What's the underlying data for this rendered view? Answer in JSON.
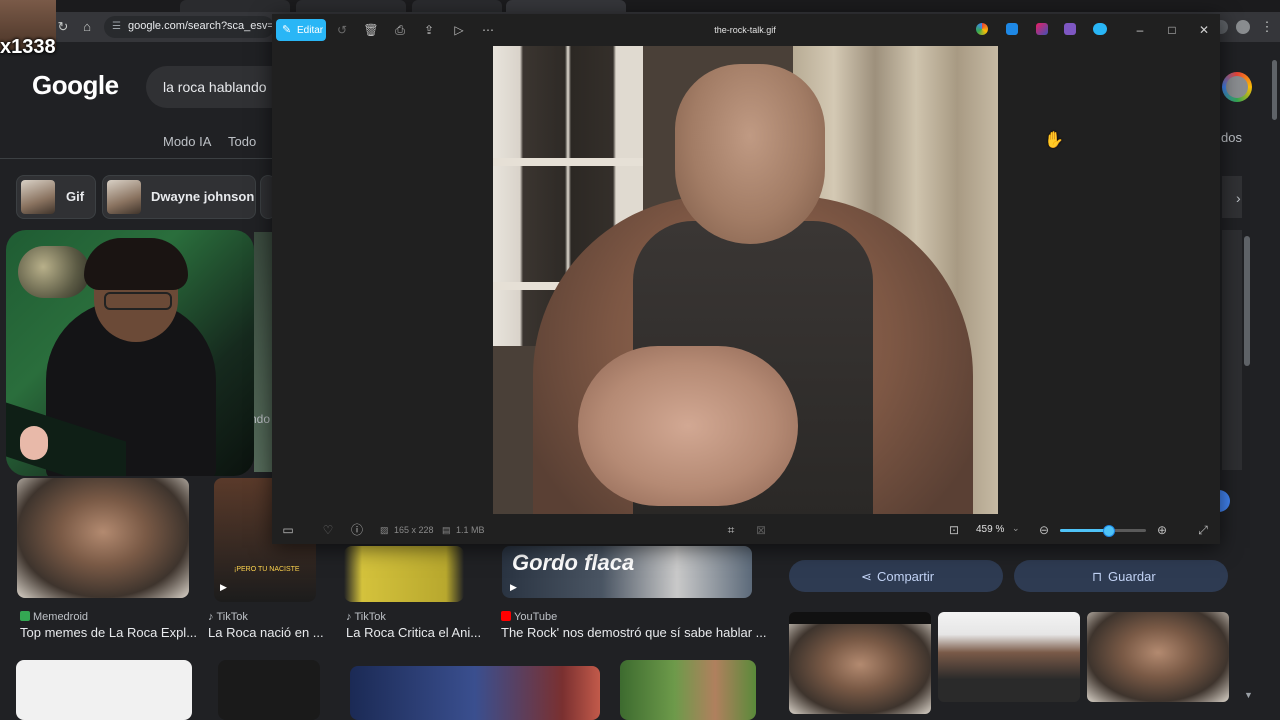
{
  "browser": {
    "address": "google.com/search?sca_esv=28495"
  },
  "overlay": {
    "streamer_name": "x1338"
  },
  "google": {
    "logo": "Google",
    "query": "la roca hablando",
    "tabs": [
      "Modo IA",
      "Todo"
    ],
    "chips": [
      {
        "label": "Gif"
      },
      {
        "label": "Dwayne johnson"
      }
    ],
    "partial_text": "ndo",
    "results": [
      {
        "source": "Memedroid",
        "title": "Top memes de La Roca Expl...",
        "color": "#34a853"
      },
      {
        "source": "TikTok",
        "title": "La Roca nació en ...",
        "color": "#000000"
      },
      {
        "source": "TikTok",
        "title": "La Roca Critica el Ani...",
        "color": "#000000"
      },
      {
        "source": "YouTube",
        "title": "The Rock' nos demostró que sí sabe hablar ...",
        "color": "#ff0000"
      }
    ],
    "thumb_caption": "¡PERO TU NACISTE",
    "gordo_text": "Gordo flaca"
  },
  "right_panel": {
    "tab_partial": "dos",
    "share_label": "Compartir",
    "save_label": "Guardar"
  },
  "viewer": {
    "edit_label": "Editar",
    "filename": "the-rock-talk.gif",
    "dimensions": "165 x 228",
    "filesize": "1.1 MB",
    "zoom": "459 %",
    "zoom_level": 0.56,
    "accent": "#29b6f6"
  }
}
